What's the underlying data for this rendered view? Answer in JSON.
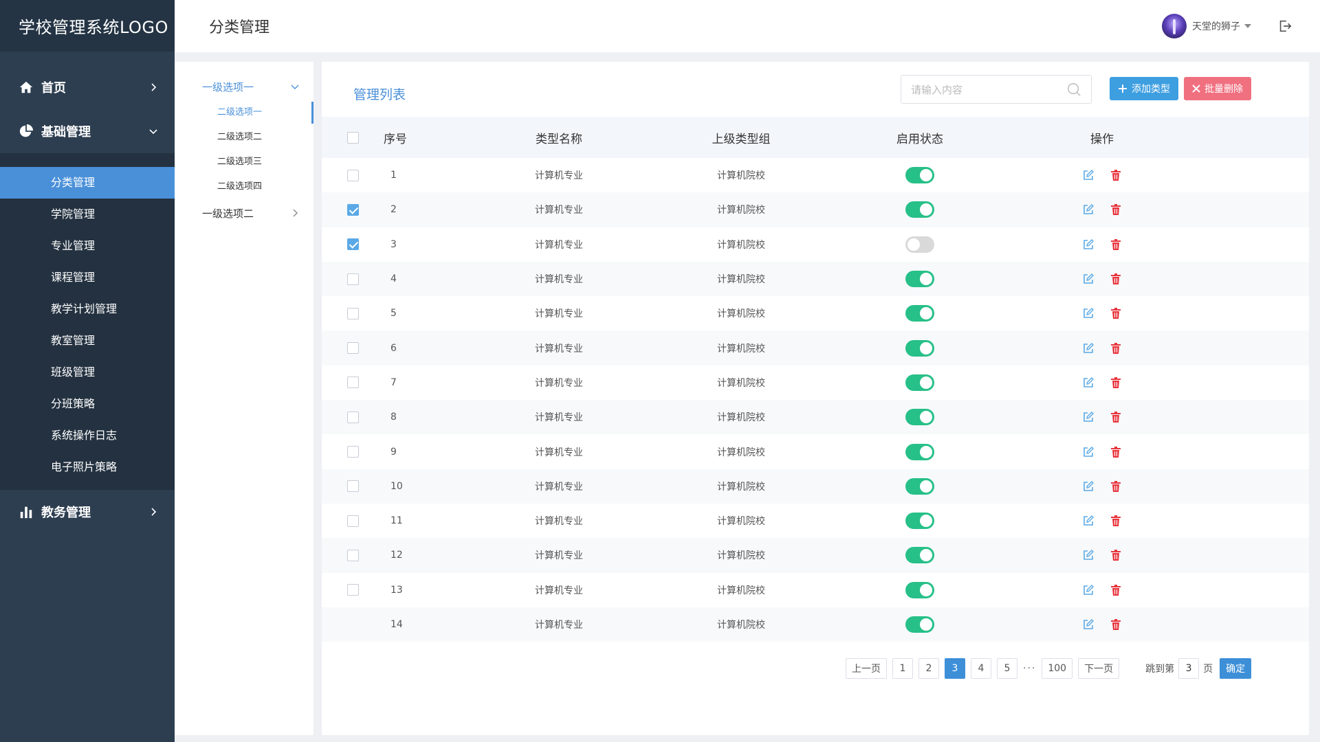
{
  "sidebar": {
    "logo": "学校管理系统LOGO",
    "top_items": [
      {
        "label": "首页",
        "icon": "home-icon"
      },
      {
        "label": "基础管理",
        "icon": "pie-chart-icon"
      },
      {
        "label": "教务管理",
        "icon": "bar-chart-icon"
      }
    ],
    "sub_items": [
      {
        "label": "分类管理",
        "active": true
      },
      {
        "label": "学院管理"
      },
      {
        "label": "专业管理"
      },
      {
        "label": "课程管理"
      },
      {
        "label": "教学计划管理"
      },
      {
        "label": "教室管理"
      },
      {
        "label": "班级管理"
      },
      {
        "label": "分班策略"
      },
      {
        "label": "系统操作日志"
      },
      {
        "label": "电子照片策略"
      }
    ],
    "colors": {
      "bg": "#2d3e50",
      "active": "#4a90d9"
    }
  },
  "header": {
    "title": "分类管理",
    "user_name": "天堂的狮子"
  },
  "tree": {
    "level1": [
      {
        "label": "一级选项一",
        "children": [
          "二级选项一",
          "二级选项二",
          "二级选项三",
          "二级选项四"
        ]
      },
      {
        "label": "一级选项二"
      }
    ]
  },
  "main": {
    "title": "管理列表",
    "search_placeholder": "请输入内容",
    "add_label": "添加类型",
    "batch_delete_label": "批量删除",
    "columns": [
      "序号",
      "类型名称",
      "上级类型组",
      "启用状态",
      "操作"
    ],
    "rows": [
      {
        "id": "1",
        "name": "计算机专业",
        "parent": "计算机院校",
        "checked": false,
        "enabled": true
      },
      {
        "id": "2",
        "name": "计算机专业",
        "parent": "计算机院校",
        "checked": true,
        "enabled": true
      },
      {
        "id": "3",
        "name": "计算机专业",
        "parent": "计算机院校",
        "checked": true,
        "enabled": false
      },
      {
        "id": "4",
        "name": "计算机专业",
        "parent": "计算机院校",
        "checked": false,
        "enabled": true
      },
      {
        "id": "5",
        "name": "计算机专业",
        "parent": "计算机院校",
        "checked": false,
        "enabled": true
      },
      {
        "id": "6",
        "name": "计算机专业",
        "parent": "计算机院校",
        "checked": false,
        "enabled": true
      },
      {
        "id": "7",
        "name": "计算机专业",
        "parent": "计算机院校",
        "checked": false,
        "enabled": true
      },
      {
        "id": "8",
        "name": "计算机专业",
        "parent": "计算机院校",
        "checked": false,
        "enabled": true
      },
      {
        "id": "9",
        "name": "计算机专业",
        "parent": "计算机院校",
        "checked": false,
        "enabled": true
      },
      {
        "id": "10",
        "name": "计算机专业",
        "parent": "计算机院校",
        "checked": false,
        "enabled": true
      },
      {
        "id": "11",
        "name": "计算机专业",
        "parent": "计算机院校",
        "checked": false,
        "enabled": true
      },
      {
        "id": "12",
        "name": "计算机专业",
        "parent": "计算机院校",
        "checked": false,
        "enabled": true
      },
      {
        "id": "13",
        "name": "计算机专业",
        "parent": "计算机院校",
        "checked": false,
        "enabled": true
      },
      {
        "id": "14",
        "name": "计算机专业",
        "parent": "计算机院校",
        "checked": null,
        "enabled": true
      }
    ],
    "colors": {
      "toggle_on": "#27c088",
      "edit": "#5aa9e6",
      "delete": "#e8343c"
    }
  },
  "pagination": {
    "prev": "上一页",
    "pages": [
      "1",
      "2",
      "3",
      "4",
      "5"
    ],
    "current": "3",
    "ellipsis": "···",
    "last": "100",
    "next": "下一页",
    "jump_prefix": "跳到第",
    "jump_value": "3",
    "jump_suffix": "页",
    "confirm": "确定"
  }
}
